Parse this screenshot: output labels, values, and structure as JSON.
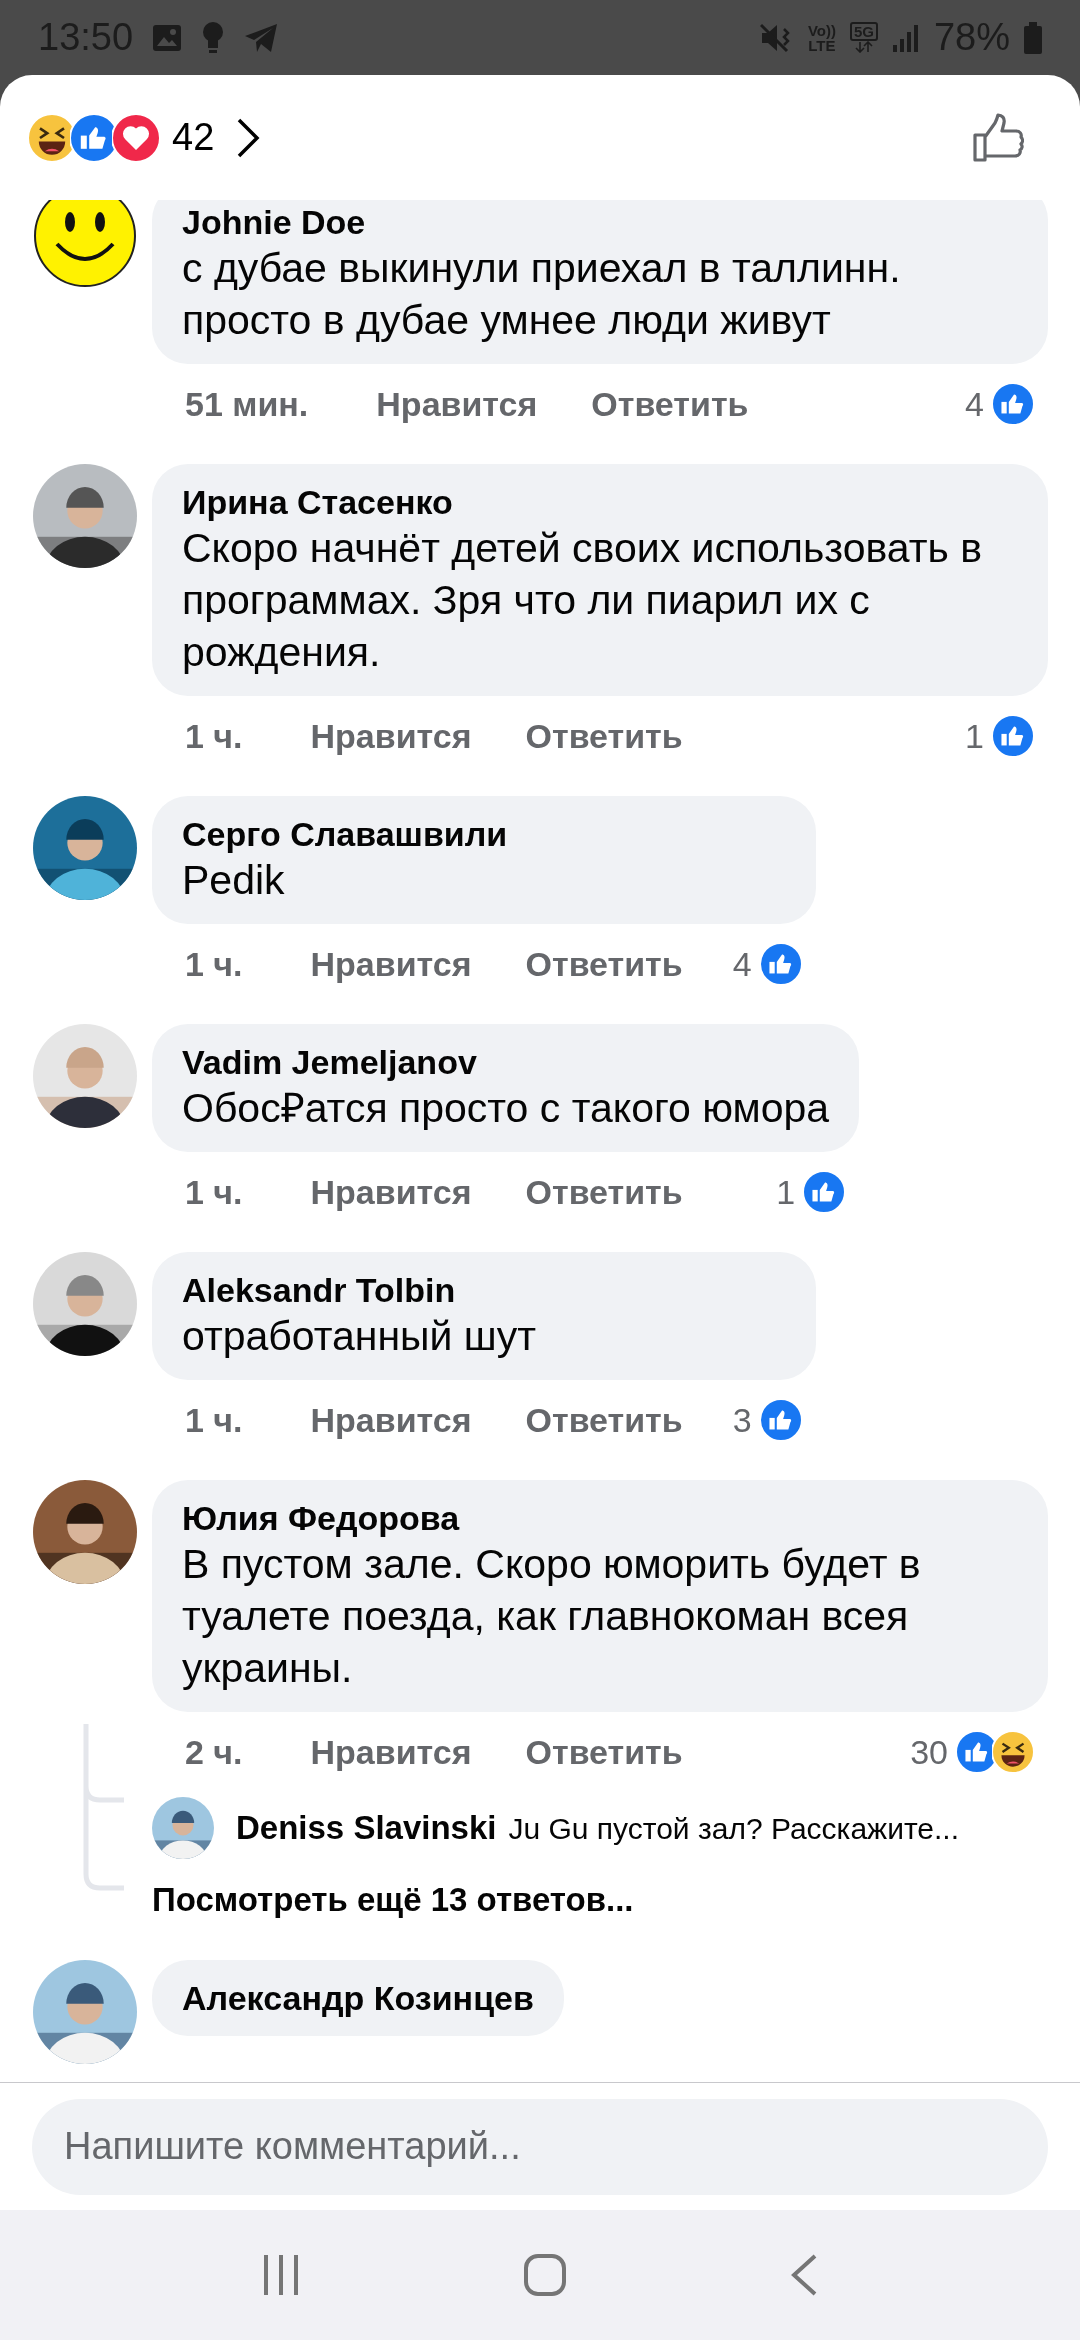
{
  "status_bar": {
    "time": "13:50",
    "volte_top": "Vo))",
    "volte_bottom": "LTE",
    "network": "5G",
    "battery": "78%"
  },
  "reactions": {
    "types": [
      {
        "kind": "haha"
      },
      {
        "kind": "like"
      },
      {
        "kind": "love"
      }
    ],
    "count": "42"
  },
  "comments": [
    {
      "author": "Johnie Doe",
      "avatar": {
        "kind": "smiley"
      },
      "text": "с дубае выкинули приехал в таллинн. просто в дубае умнее люди живут",
      "time": "51 мин.",
      "like_label": "Нравится",
      "reply_label": "Ответить",
      "reaction_count": "4",
      "reaction_types": [
        {
          "kind": "like"
        }
      ]
    },
    {
      "author": "Ирина Стасенко",
      "avatar": {
        "kind": "picture"
      },
      "text": "Скоро начнёт детей своих использовать в программах. Зря что ли пиарил их с рождения.",
      "time": "1 ч.",
      "like_label": "Нравится",
      "reply_label": "Ответить",
      "reaction_count": "1",
      "reaction_types": [
        {
          "kind": "like"
        }
      ]
    },
    {
      "author": "Серго Славашвили",
      "avatar": {
        "kind": "picture"
      },
      "text": "Pedik",
      "time": "1 ч.",
      "like_label": "Нравится",
      "reply_label": "Ответить",
      "reaction_count": "4",
      "reaction_types": [
        {
          "kind": "like"
        }
      ]
    },
    {
      "author": "Vadim Jemeljanov",
      "avatar": {
        "kind": "picture"
      },
      "text": "Обос₽атся просто с такого юмора",
      "time": "1 ч.",
      "like_label": "Нравится",
      "reply_label": "Ответить",
      "reaction_count": "1",
      "reaction_types": [
        {
          "kind": "like"
        }
      ]
    },
    {
      "author": "Aleksandr Tolbin",
      "avatar": {
        "kind": "picture"
      },
      "text": "отработанный шут",
      "time": "1 ч.",
      "like_label": "Нравится",
      "reply_label": "Ответить",
      "reaction_count": "3",
      "reaction_types": [
        {
          "kind": "like"
        }
      ]
    },
    {
      "author": "Юлия Федорова",
      "avatar": {
        "kind": "picture"
      },
      "text": "В пустом зале. Скоро юморить будет в туалете поезда, как главнокоман всея украины.",
      "time": "2 ч.",
      "like_label": "Нравится",
      "reply_label": "Ответить",
      "reaction_count": "30",
      "reaction_types": [
        {
          "kind": "like"
        },
        {
          "kind": "haha"
        }
      ],
      "replies": [
        {
          "author": "Deniss Slavinski",
          "text": "Ju Gu пустой зал? Расскажите..."
        }
      ],
      "more_replies": "Посмотреть ещё 13 ответов..."
    },
    {
      "author": "Александр Козинцев",
      "avatar": {
        "kind": "picture"
      }
    }
  ],
  "composer": {
    "placeholder": "Напишите комментарий..."
  }
}
